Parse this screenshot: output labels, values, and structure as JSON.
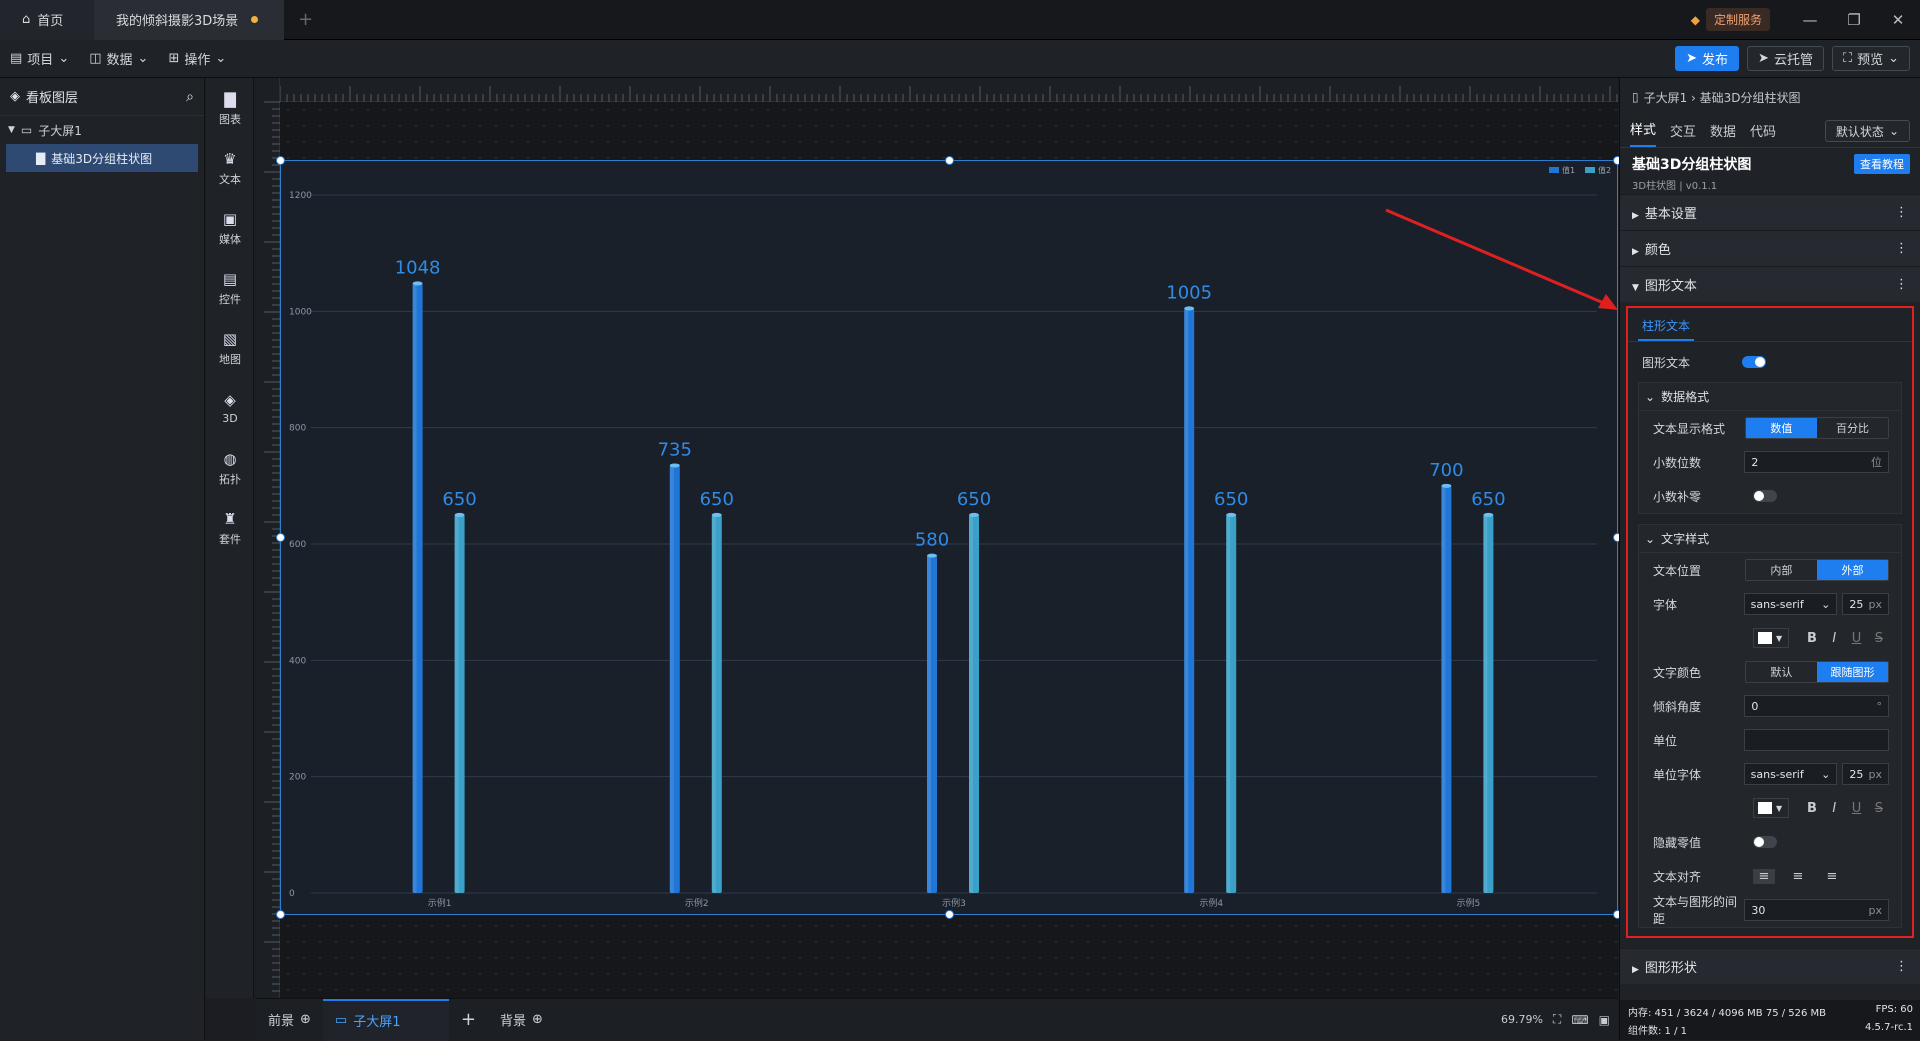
{
  "titlebar": {
    "home_tab": "首页",
    "scene_tab": "我的倾斜摄影3D场景",
    "custom_service": "定制服务",
    "min": "—",
    "max": "❐",
    "close": "✕"
  },
  "menubar": {
    "project": "项目",
    "data": "数据",
    "ops": "操作",
    "publish": "发布",
    "cloud": "云托管",
    "preview": "预览"
  },
  "layers": {
    "title": "看板图层",
    "screen": "子大屏1",
    "chart": "基础3D分组柱状图"
  },
  "tools": [
    {
      "icon": "▇",
      "label": "图表"
    },
    {
      "icon": "♛",
      "label": "文本"
    },
    {
      "icon": "▣",
      "label": "媒体"
    },
    {
      "icon": "▤",
      "label": "控件"
    },
    {
      "icon": "▧",
      "label": "地图"
    },
    {
      "icon": "◈",
      "label": "3D"
    },
    {
      "icon": "◍",
      "label": "拓扑"
    },
    {
      "icon": "♜",
      "label": "套件"
    }
  ],
  "bottombar": {
    "front": "前景",
    "screen": "子大屏1",
    "bg": "背景",
    "zoom": "69.79%"
  },
  "panel": {
    "crumb": "子大屏1 › 基础3D分组柱状图",
    "tabs": [
      "样式",
      "交互",
      "数据",
      "代码"
    ],
    "state": "默认状态",
    "comp_title": "基础3D分组柱状图",
    "comp_sub": "3D柱状图 | v0.1.1",
    "tutorial": "查看教程",
    "sec_basic": "基本设置",
    "sec_color": "颜色",
    "sec_text": "图形文本",
    "subtab": "柱形文本",
    "graphic_text": "图形文本",
    "data_format": "数据格式",
    "text_display_fmt": "文本显示格式",
    "fmt_value": "数值",
    "fmt_percent": "百分比",
    "decimals": "小数位数",
    "decimals_val": "2",
    "decimals_unit": "位",
    "pad_zero": "小数补零",
    "text_style": "文字样式",
    "text_pos": "文本位置",
    "pos_in": "内部",
    "pos_out": "外部",
    "font": "字体",
    "font_val": "sans-serif",
    "font_size": "25",
    "px": "px",
    "text_color": "文字颜色",
    "color_default": "默认",
    "color_follow": "跟随图形",
    "tilt": "倾斜角度",
    "tilt_val": "0",
    "deg": "°",
    "unit": "单位",
    "unit_font": "单位字体",
    "hide_zero": "隐藏零值",
    "align": "文本对齐",
    "gap": "文本与图形的间距",
    "gap_val": "30",
    "sec_shape": "图形形状",
    "status_mem": "内存: 451 / 3624 / 4096 MB  75 / 526 MB",
    "status_fps": "FPS: 60",
    "status_count": "组件数: 1 / 1",
    "status_ver": "4.5.7-rc.1"
  },
  "chart_data": {
    "type": "bar",
    "categories": [
      "示例1",
      "示例2",
      "示例3",
      "示例4",
      "示例5"
    ],
    "series": [
      {
        "name": "值1",
        "values": [
          1048,
          735,
          580,
          1005,
          700
        ]
      },
      {
        "name": "值2",
        "values": [
          650,
          650,
          650,
          650,
          650
        ]
      }
    ],
    "ylim": [
      0,
      1200
    ],
    "yticks": [
      0,
      200,
      400,
      600,
      800,
      1000,
      1200
    ],
    "colors": [
      "#1f76d6",
      "#3aa0c8"
    ],
    "label_color": "#2f8be6",
    "grid": true,
    "legend": "top-right"
  },
  "colors": {
    "accent": "#1e7ef0",
    "highlight_box": "#e02020",
    "arrow": "#e02020"
  }
}
